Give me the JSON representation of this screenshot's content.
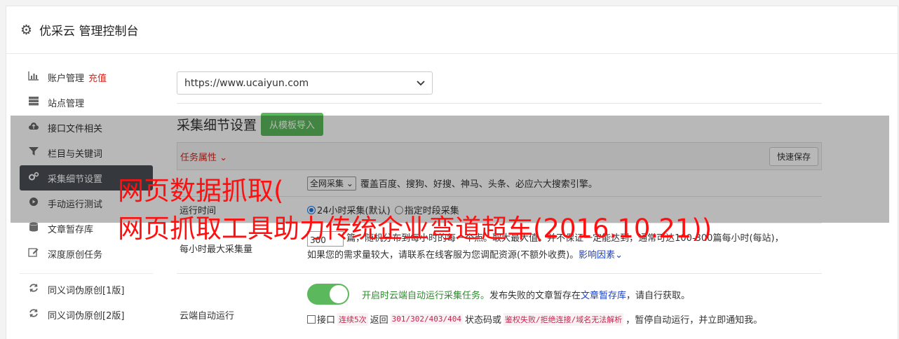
{
  "header": {
    "title": "优采云 管理控制台",
    "icon": "gear-icon"
  },
  "sidebar": {
    "items": [
      {
        "label": "账户管理",
        "badge": "充值",
        "icon": "bar-chart-icon"
      },
      {
        "label": "站点管理",
        "icon": "server-icon"
      },
      {
        "label": "接口文件相关",
        "icon": "cloud-upload-icon"
      },
      {
        "label": "栏目与关键词",
        "icon": "filter-icon"
      },
      {
        "label": "采集细节设置",
        "icon": "gears-icon"
      },
      {
        "label": "手动运行测试",
        "icon": "play-icon"
      },
      {
        "label": "文章暂存库",
        "icon": "database-icon"
      },
      {
        "label": "深度原创任务",
        "icon": "edit-icon"
      }
    ],
    "items2": [
      {
        "label": "同义词伪原创[1版]",
        "icon": "refresh-icon"
      },
      {
        "label": "同义词伪原创[2版]",
        "icon": "refresh-icon"
      }
    ]
  },
  "main": {
    "site_select": "https://www.ucaiyun.com",
    "section_title": "采集细节设置",
    "import_button": "从模板导入",
    "task_attr": "任务属性",
    "quick_save": "快速保存",
    "scope_select": "全网采集",
    "scope_desc": "覆盖百度、搜狗、好搜、神马、头条、必应六大搜索引擎。",
    "run_time_label": "运行时间",
    "run_time_opt1": "24小时采集(默认)",
    "run_time_opt2": "指定时段采集",
    "per_hour_label": "每小时最大采集量",
    "per_hour_value": "300",
    "per_hour_desc1": "篇，随机分布到每小时的每一个点。取大最大值。并不保证一定能达到，通常可达100-300篇每小时(每站)，",
    "per_hour_desc2": "如果您的需求量较大，请联系在线客服为您调配资源(不额外收费)。",
    "per_hour_link": "影响因素",
    "cloud_label": "云端自动运行",
    "cloud_desc_green": "开启时云端自动运行采集任务。",
    "cloud_desc_mid": "发布失败的文章暂存在",
    "cloud_desc_link": "文章暂存库",
    "cloud_desc_end": "，请自行获取。",
    "api_text1": "接口",
    "api_code1": "连续5次",
    "api_text2": "返回",
    "api_code2": "301/302/403/404",
    "api_text3": "状态码或",
    "api_code3": "鉴权失败/拒绝连接/域名无法解析",
    "api_text4": "，暂停自动运行，并立即通知我。"
  },
  "overlay": {
    "line1": "网页数据抓取(",
    "line2": "网页抓取工具助力传统企业弯道超车(2016.10.21))"
  },
  "colors": {
    "accent_green": "#5cb85c",
    "active_bg": "#4a4f56",
    "danger": "#d9251c",
    "overlay_text": "#ff1010"
  }
}
